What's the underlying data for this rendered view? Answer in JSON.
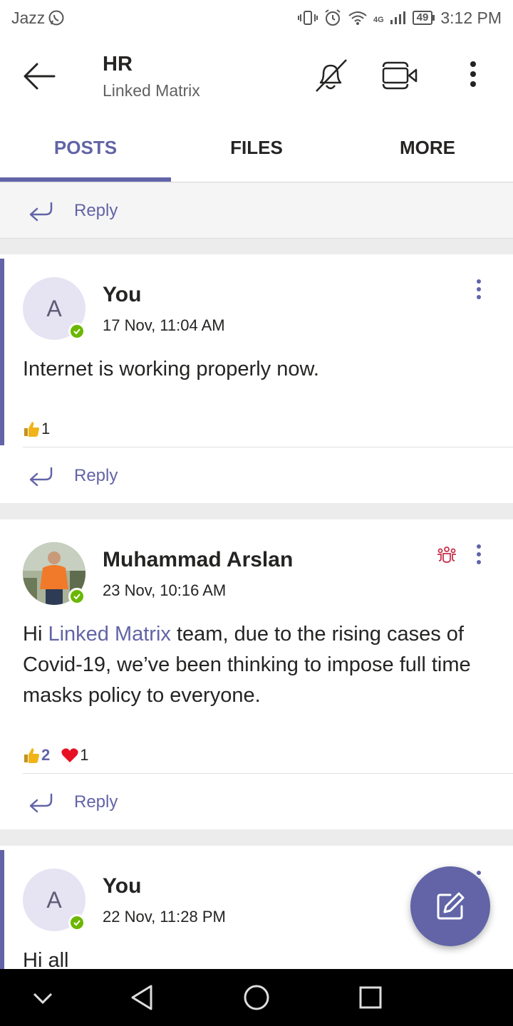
{
  "status_bar": {
    "carrier": "Jazz",
    "network": "4G",
    "battery": "49",
    "time": "3:12 PM"
  },
  "header": {
    "title": "HR",
    "subtitle": "Linked Matrix"
  },
  "tabs": [
    {
      "label": "POSTS",
      "active": true
    },
    {
      "label": "FILES",
      "active": false
    },
    {
      "label": "MORE",
      "active": false
    }
  ],
  "reply_label": "Reply",
  "posts": [
    {
      "author": "You",
      "avatar_initial": "A",
      "time": "17 Nov, 11:04 AM",
      "message": "Internet is working properly now.",
      "likes": "1"
    },
    {
      "author": "Muhammad Arslan",
      "time": "23 Nov, 10:16 AM",
      "message_prefix": "Hi ",
      "mention": "Linked Matrix",
      "message_suffix": " team, due to the rising cases of Covid-19, we’ve been thinking to impose full time masks policy to everyone.",
      "likes": "2",
      "hearts": "1"
    },
    {
      "author": "You",
      "avatar_initial": "A",
      "time": "22 Nov, 11:28 PM",
      "message": "Hi all"
    }
  ],
  "colors": {
    "accent": "#6264a7",
    "presence_available": "#6bb700",
    "heart": "#e81123",
    "like": "#f0b419"
  },
  "icons": [
    "whatsapp-icon",
    "back-arrow-icon",
    "mute-bell-icon",
    "video-call-icon",
    "more-vertical-icon",
    "reply-icon",
    "like-icon",
    "heart-icon",
    "team-icon",
    "compose-icon",
    "nav-collapse-icon",
    "nav-back-icon",
    "nav-home-icon",
    "nav-recents-icon"
  ]
}
